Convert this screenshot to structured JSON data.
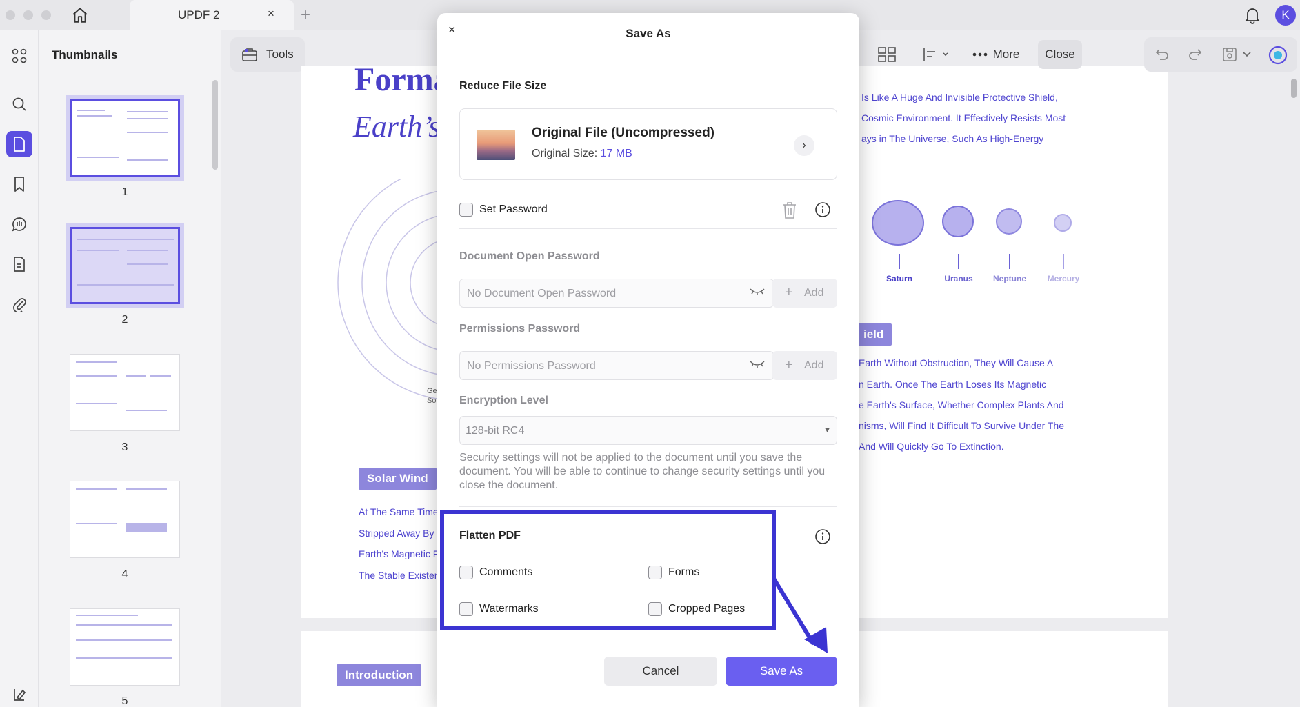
{
  "app": {
    "tab_title": "UPDF 2",
    "tab_close": "×",
    "new_tab": "+",
    "avatar_letter": "K"
  },
  "left_rail": {
    "icons": [
      "grid-icon",
      "search-icon",
      "document-icon",
      "bookmark-icon",
      "comment-icon",
      "pages-icon",
      "paperclip-icon",
      "layers-icon"
    ]
  },
  "thumbnails": {
    "title": "Thumbnails",
    "pages": [
      "1",
      "2",
      "3",
      "4",
      "5"
    ],
    "selected_page": "1"
  },
  "toolbar": {
    "tools_label": "Tools",
    "more_label": "More",
    "close_label": "Close"
  },
  "document": {
    "title_line1": "Forma",
    "title_line2": "Earth’s",
    "chip_solar_wind": "Solar Wind",
    "chip_introduction": "Introduction",
    "chip_shield": "ield",
    "left_lines": [
      "At The Same Time",
      "Stripped Away By",
      "Earth's Magnetic F",
      "The Stable Existen"
    ],
    "right_lines_top": [
      "Is Like A Huge And Invisible Protective Shield,",
      "Cosmic Environment. It Effectively Resists Most",
      "ays in The Universe, Such As High-Energy"
    ],
    "right_lines_bottom": [
      "Earth Without Obstruction, They Will Cause A",
      "n Earth. Once The Earth Loses Its Magnetic",
      "e Earth's Surface, Whether Complex Plants And",
      "nisms, Will Find It Difficult To Survive Under The",
      "And Will Quickly Go To Extinction."
    ],
    "planets": [
      "Saturn",
      "Uranus",
      "Neptune",
      "Mercury"
    ],
    "diagram_labels": [
      "Ge",
      "So"
    ]
  },
  "dialog": {
    "title": "Save As",
    "close": "×",
    "reduce_section": "Reduce File Size",
    "file_name": "Original File (Uncompressed)",
    "file_size_label": "Original Size:",
    "file_size_value": "17 MB",
    "file_arrow": "›",
    "set_password_label": "Set Password",
    "set_password_checked": false,
    "open_password_label": "Document Open Password",
    "open_password_placeholder": "No Document Open Password",
    "permissions_label": "Permissions Password",
    "permissions_placeholder": "No Permissions Password",
    "add_label": "Add",
    "add_plus": "+",
    "encryption_label": "Encryption Level",
    "encryption_value": "128-bit RC4",
    "encryption_caret": "▼",
    "security_note": "Security settings will not be applied to the document until you save the document. You will be able to continue to change security settings until you close the document.",
    "flatten_title": "Flatten PDF",
    "flatten_options": [
      {
        "label": "Comments",
        "checked": false
      },
      {
        "label": "Forms",
        "checked": false
      },
      {
        "label": "Watermarks",
        "checked": false
      },
      {
        "label": "Cropped Pages",
        "checked": false
      }
    ],
    "cancel_label": "Cancel",
    "save_label": "Save As"
  },
  "colors": {
    "accent": "#5b4ee0",
    "highlight": "#3b34d2",
    "save_button": "#6a5ff0",
    "doc_text": "#4f45d0"
  }
}
